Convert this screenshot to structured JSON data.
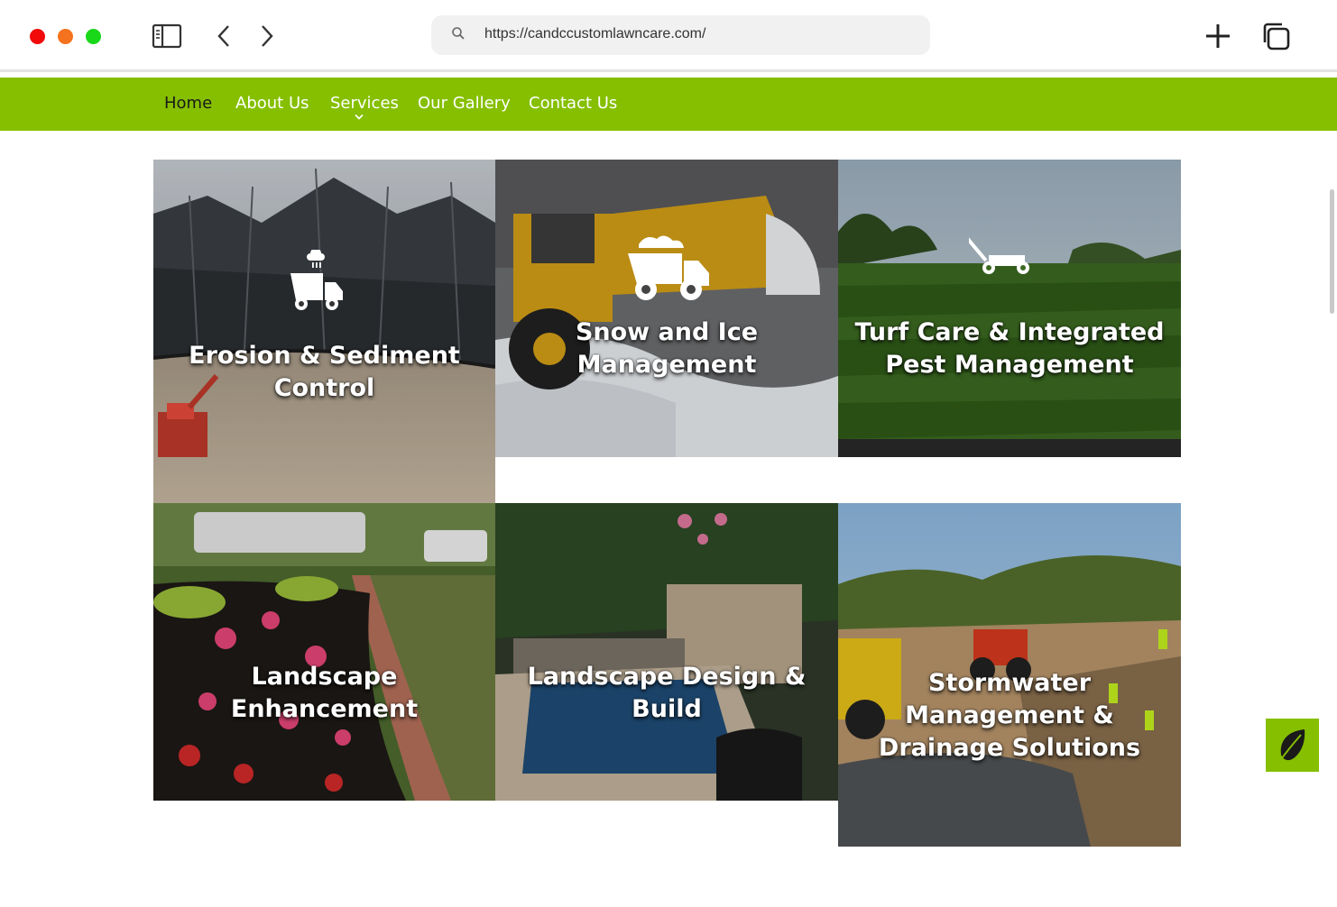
{
  "browser": {
    "url": "https://candccustomlawncare.com/",
    "icons": [
      "sidebar-icon",
      "back-icon",
      "forward-icon",
      "search-icon",
      "new-tab-icon",
      "tabs-icon"
    ]
  },
  "nav": {
    "items": [
      {
        "label": "Home",
        "active": true
      },
      {
        "label": "About Us"
      },
      {
        "label": "Services",
        "has_dropdown": true
      },
      {
        "label": "Our Gallery"
      },
      {
        "label": "Contact Us"
      }
    ],
    "color": "#85bf00"
  },
  "tiles": [
    {
      "line1": "Erosion & Sediment",
      "line2": "Control",
      "icon": "dump-truck-icon"
    },
    {
      "line1": "Snow and Ice",
      "line2": "Management",
      "icon": "dump-truck-icon"
    },
    {
      "line1": "Turf Care & Integrated",
      "line2": "Pest Management",
      "icon": "lawn-mower-icon"
    },
    {
      "line1": "Landscape",
      "line2": "Enhancement"
    },
    {
      "line1": "Landscape Design &",
      "line2": "Build"
    },
    {
      "line1": "Stormwater",
      "line2": "Management &",
      "line3": "Drainage Solutions"
    }
  ],
  "floating_button": {
    "icon": "leaf-icon"
  }
}
